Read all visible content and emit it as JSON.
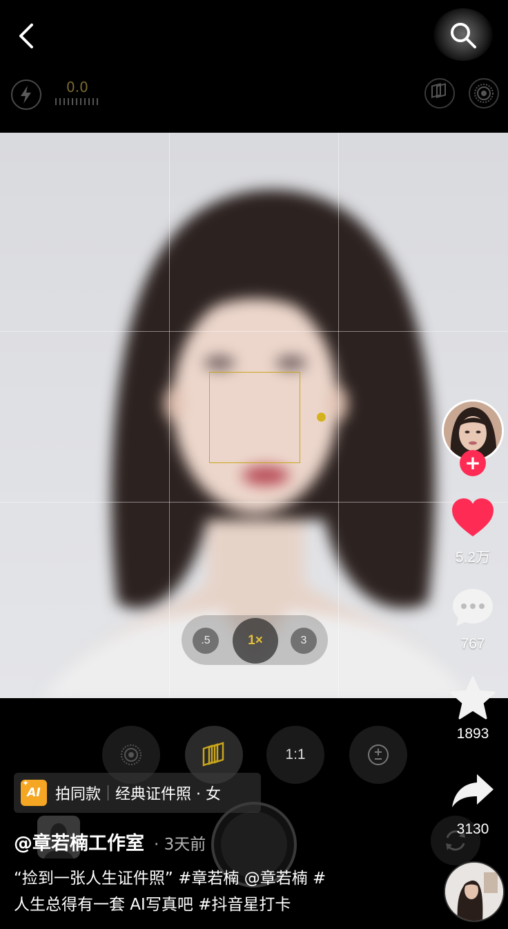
{
  "camera": {
    "exposure_value": "0.0",
    "zoom_options": [
      ".5",
      "1×",
      "3"
    ],
    "aspect_ratio_label": "1:1",
    "colors": {
      "accent_yellow": "#d4b21e",
      "bar_background": "#000000"
    }
  },
  "creator": {
    "author_name": "@章若楠工作室",
    "post_time": "· 3天前",
    "follow_symbol": "+"
  },
  "actions": {
    "likes": "5.2万",
    "comments": "767",
    "favorites": "1893",
    "shares": "3130",
    "like_color": "#fe2c55"
  },
  "template_tag": {
    "badge": "AI",
    "action": "拍同款",
    "template_name": "经典证件照 · 女"
  },
  "caption": {
    "line1": "“捡到一张人生证件照” #章若楠 @章若楠 #",
    "line2": "人生总得有一套 AI写真吧 #抖音星打卡"
  },
  "icons": [
    "back-arrow-icon",
    "search-icon",
    "flash-icon",
    "layers-icon",
    "live-photo-icon",
    "heart-icon",
    "comment-icon",
    "star-icon",
    "share-icon",
    "exposure-icon",
    "flip-camera-icon"
  ]
}
